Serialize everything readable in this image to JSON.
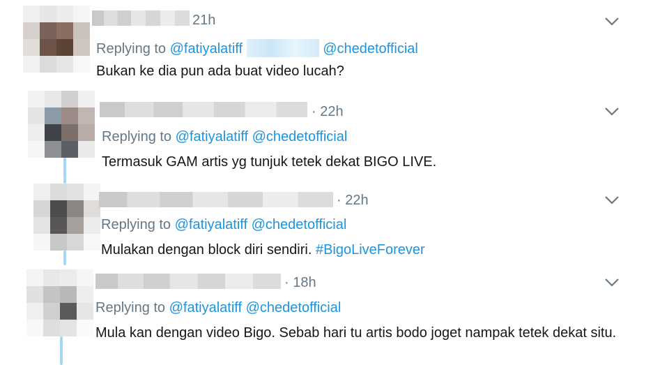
{
  "replies": [
    {
      "time": "21h",
      "replying_label": "Replying to",
      "mentions": [
        "@fatiyalatiff",
        "@chedetofficial"
      ],
      "text": "Bukan ke dia pun ada buat video lucah?",
      "icon": "chevron-down-icon"
    },
    {
      "time": "· 22h",
      "replying_label": "Replying to",
      "mentions": [
        "@fatiyalatiff",
        "@chedetofficial"
      ],
      "text": "Termasuk GAM artis yg tunjuk tetek dekat BIGO LIVE.",
      "icon": "chevron-down-icon"
    },
    {
      "time": "· 22h",
      "replying_label": "Replying to",
      "mentions": [
        "@fatiyalatiff",
        "@chedetofficial"
      ],
      "text": "Mulakan dengan block diri sendiri. ",
      "hashtag": "#BigoLiveForever",
      "icon": "chevron-down-icon"
    },
    {
      "time": "· 18h",
      "replying_label": "Replying to",
      "mentions": [
        "@fatiyalatiff",
        "@chedetofficial"
      ],
      "text": "Mula kan dengan video Bigo. Sebab hari tu artis bodo joget nampak tetek dekat situ.",
      "icon": "chevron-down-icon"
    }
  ],
  "colors": {
    "link": "#1b95e0",
    "muted": "#657786",
    "thread": "#a3d7f5",
    "text": "#14171a"
  }
}
